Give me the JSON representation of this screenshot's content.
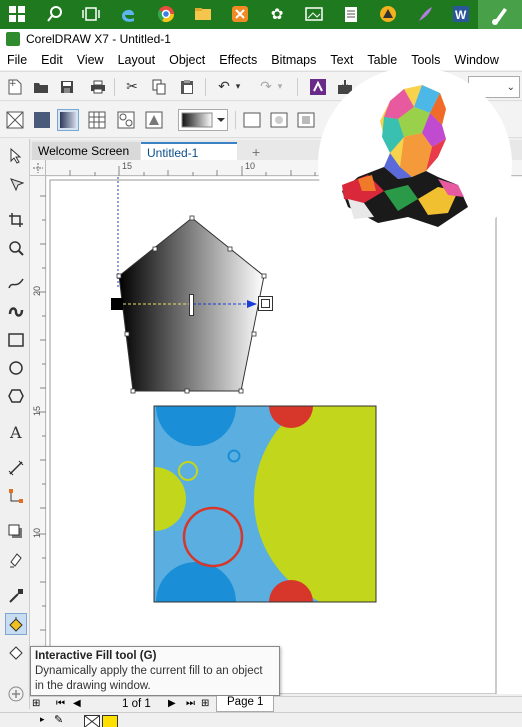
{
  "window": {
    "title": "CorelDRAW X7 - Untitled-1"
  },
  "menubar": {
    "items": [
      "File",
      "Edit",
      "View",
      "Layout",
      "Object",
      "Effects",
      "Bitmaps",
      "Text",
      "Table",
      "Tools",
      "Window"
    ]
  },
  "tabs": {
    "welcome": "Welcome Screen",
    "untitled": "Untitled-1",
    "add": "+"
  },
  "rulers": {
    "top": [
      "15",
      "10"
    ],
    "left": [
      "20",
      "15",
      "10"
    ]
  },
  "tooltip": {
    "title": "Interactive Fill tool (G)",
    "description_line1": "Dynamically apply the current fill to an object",
    "description_line2": "in the drawing window."
  },
  "pagebar": {
    "page_count": "1 of 1",
    "page_tab": "Page 1"
  },
  "colors": {
    "taskbar": "#1f7a1f",
    "pattern_bg": "#5aaee0",
    "pattern_green": "#c2d61b",
    "pattern_red": "#d7372a",
    "pattern_blue": "#1a8ed6",
    "accent": "#3b82c4",
    "swatch_yellow": "#ffe000"
  }
}
